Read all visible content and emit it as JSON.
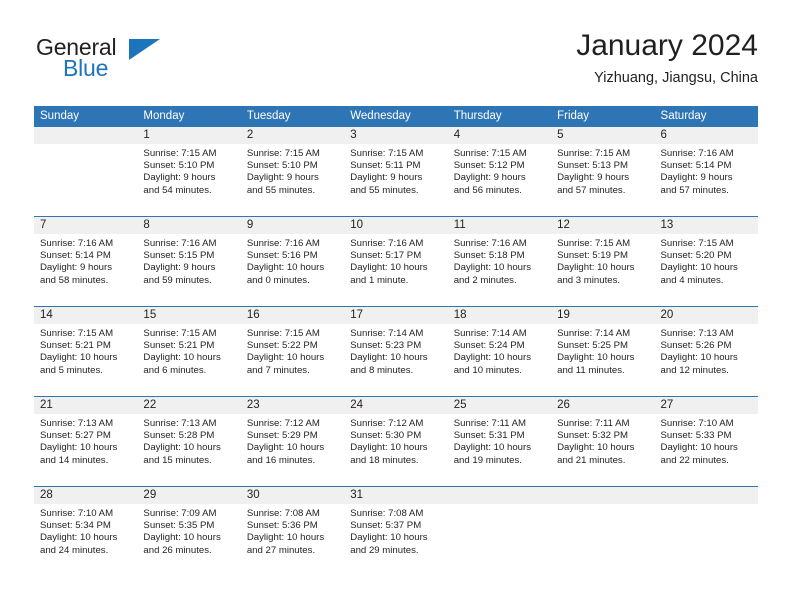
{
  "brand": {
    "name_part1": "General",
    "name_part2": "Blue",
    "accent_color": "#1c75bc"
  },
  "header": {
    "title": "January 2024",
    "subtitle": "Yizhuang, Jiangsu, China",
    "header_bg_color": "#2e75b6"
  },
  "weekdays": [
    "Sunday",
    "Monday",
    "Tuesday",
    "Wednesday",
    "Thursday",
    "Friday",
    "Saturday"
  ],
  "weeks": [
    [
      {
        "day": "",
        "sunrise": "",
        "sunset": "",
        "daylight1": "",
        "daylight2": ""
      },
      {
        "day": "1",
        "sunrise": "Sunrise: 7:15 AM",
        "sunset": "Sunset: 5:10 PM",
        "daylight1": "Daylight: 9 hours",
        "daylight2": "and 54 minutes."
      },
      {
        "day": "2",
        "sunrise": "Sunrise: 7:15 AM",
        "sunset": "Sunset: 5:10 PM",
        "daylight1": "Daylight: 9 hours",
        "daylight2": "and 55 minutes."
      },
      {
        "day": "3",
        "sunrise": "Sunrise: 7:15 AM",
        "sunset": "Sunset: 5:11 PM",
        "daylight1": "Daylight: 9 hours",
        "daylight2": "and 55 minutes."
      },
      {
        "day": "4",
        "sunrise": "Sunrise: 7:15 AM",
        "sunset": "Sunset: 5:12 PM",
        "daylight1": "Daylight: 9 hours",
        "daylight2": "and 56 minutes."
      },
      {
        "day": "5",
        "sunrise": "Sunrise: 7:15 AM",
        "sunset": "Sunset: 5:13 PM",
        "daylight1": "Daylight: 9 hours",
        "daylight2": "and 57 minutes."
      },
      {
        "day": "6",
        "sunrise": "Sunrise: 7:16 AM",
        "sunset": "Sunset: 5:14 PM",
        "daylight1": "Daylight: 9 hours",
        "daylight2": "and 57 minutes."
      }
    ],
    [
      {
        "day": "7",
        "sunrise": "Sunrise: 7:16 AM",
        "sunset": "Sunset: 5:14 PM",
        "daylight1": "Daylight: 9 hours",
        "daylight2": "and 58 minutes."
      },
      {
        "day": "8",
        "sunrise": "Sunrise: 7:16 AM",
        "sunset": "Sunset: 5:15 PM",
        "daylight1": "Daylight: 9 hours",
        "daylight2": "and 59 minutes."
      },
      {
        "day": "9",
        "sunrise": "Sunrise: 7:16 AM",
        "sunset": "Sunset: 5:16 PM",
        "daylight1": "Daylight: 10 hours",
        "daylight2": "and 0 minutes."
      },
      {
        "day": "10",
        "sunrise": "Sunrise: 7:16 AM",
        "sunset": "Sunset: 5:17 PM",
        "daylight1": "Daylight: 10 hours",
        "daylight2": "and 1 minute."
      },
      {
        "day": "11",
        "sunrise": "Sunrise: 7:16 AM",
        "sunset": "Sunset: 5:18 PM",
        "daylight1": "Daylight: 10 hours",
        "daylight2": "and 2 minutes."
      },
      {
        "day": "12",
        "sunrise": "Sunrise: 7:15 AM",
        "sunset": "Sunset: 5:19 PM",
        "daylight1": "Daylight: 10 hours",
        "daylight2": "and 3 minutes."
      },
      {
        "day": "13",
        "sunrise": "Sunrise: 7:15 AM",
        "sunset": "Sunset: 5:20 PM",
        "daylight1": "Daylight: 10 hours",
        "daylight2": "and 4 minutes."
      }
    ],
    [
      {
        "day": "14",
        "sunrise": "Sunrise: 7:15 AM",
        "sunset": "Sunset: 5:21 PM",
        "daylight1": "Daylight: 10 hours",
        "daylight2": "and 5 minutes."
      },
      {
        "day": "15",
        "sunrise": "Sunrise: 7:15 AM",
        "sunset": "Sunset: 5:21 PM",
        "daylight1": "Daylight: 10 hours",
        "daylight2": "and 6 minutes."
      },
      {
        "day": "16",
        "sunrise": "Sunrise: 7:15 AM",
        "sunset": "Sunset: 5:22 PM",
        "daylight1": "Daylight: 10 hours",
        "daylight2": "and 7 minutes."
      },
      {
        "day": "17",
        "sunrise": "Sunrise: 7:14 AM",
        "sunset": "Sunset: 5:23 PM",
        "daylight1": "Daylight: 10 hours",
        "daylight2": "and 8 minutes."
      },
      {
        "day": "18",
        "sunrise": "Sunrise: 7:14 AM",
        "sunset": "Sunset: 5:24 PM",
        "daylight1": "Daylight: 10 hours",
        "daylight2": "and 10 minutes."
      },
      {
        "day": "19",
        "sunrise": "Sunrise: 7:14 AM",
        "sunset": "Sunset: 5:25 PM",
        "daylight1": "Daylight: 10 hours",
        "daylight2": "and 11 minutes."
      },
      {
        "day": "20",
        "sunrise": "Sunrise: 7:13 AM",
        "sunset": "Sunset: 5:26 PM",
        "daylight1": "Daylight: 10 hours",
        "daylight2": "and 12 minutes."
      }
    ],
    [
      {
        "day": "21",
        "sunrise": "Sunrise: 7:13 AM",
        "sunset": "Sunset: 5:27 PM",
        "daylight1": "Daylight: 10 hours",
        "daylight2": "and 14 minutes."
      },
      {
        "day": "22",
        "sunrise": "Sunrise: 7:13 AM",
        "sunset": "Sunset: 5:28 PM",
        "daylight1": "Daylight: 10 hours",
        "daylight2": "and 15 minutes."
      },
      {
        "day": "23",
        "sunrise": "Sunrise: 7:12 AM",
        "sunset": "Sunset: 5:29 PM",
        "daylight1": "Daylight: 10 hours",
        "daylight2": "and 16 minutes."
      },
      {
        "day": "24",
        "sunrise": "Sunrise: 7:12 AM",
        "sunset": "Sunset: 5:30 PM",
        "daylight1": "Daylight: 10 hours",
        "daylight2": "and 18 minutes."
      },
      {
        "day": "25",
        "sunrise": "Sunrise: 7:11 AM",
        "sunset": "Sunset: 5:31 PM",
        "daylight1": "Daylight: 10 hours",
        "daylight2": "and 19 minutes."
      },
      {
        "day": "26",
        "sunrise": "Sunrise: 7:11 AM",
        "sunset": "Sunset: 5:32 PM",
        "daylight1": "Daylight: 10 hours",
        "daylight2": "and 21 minutes."
      },
      {
        "day": "27",
        "sunrise": "Sunrise: 7:10 AM",
        "sunset": "Sunset: 5:33 PM",
        "daylight1": "Daylight: 10 hours",
        "daylight2": "and 22 minutes."
      }
    ],
    [
      {
        "day": "28",
        "sunrise": "Sunrise: 7:10 AM",
        "sunset": "Sunset: 5:34 PM",
        "daylight1": "Daylight: 10 hours",
        "daylight2": "and 24 minutes."
      },
      {
        "day": "29",
        "sunrise": "Sunrise: 7:09 AM",
        "sunset": "Sunset: 5:35 PM",
        "daylight1": "Daylight: 10 hours",
        "daylight2": "and 26 minutes."
      },
      {
        "day": "30",
        "sunrise": "Sunrise: 7:08 AM",
        "sunset": "Sunset: 5:36 PM",
        "daylight1": "Daylight: 10 hours",
        "daylight2": "and 27 minutes."
      },
      {
        "day": "31",
        "sunrise": "Sunrise: 7:08 AM",
        "sunset": "Sunset: 5:37 PM",
        "daylight1": "Daylight: 10 hours",
        "daylight2": "and 29 minutes."
      },
      {
        "day": "",
        "sunrise": "",
        "sunset": "",
        "daylight1": "",
        "daylight2": ""
      },
      {
        "day": "",
        "sunrise": "",
        "sunset": "",
        "daylight1": "",
        "daylight2": ""
      },
      {
        "day": "",
        "sunrise": "",
        "sunset": "",
        "daylight1": "",
        "daylight2": ""
      }
    ]
  ]
}
